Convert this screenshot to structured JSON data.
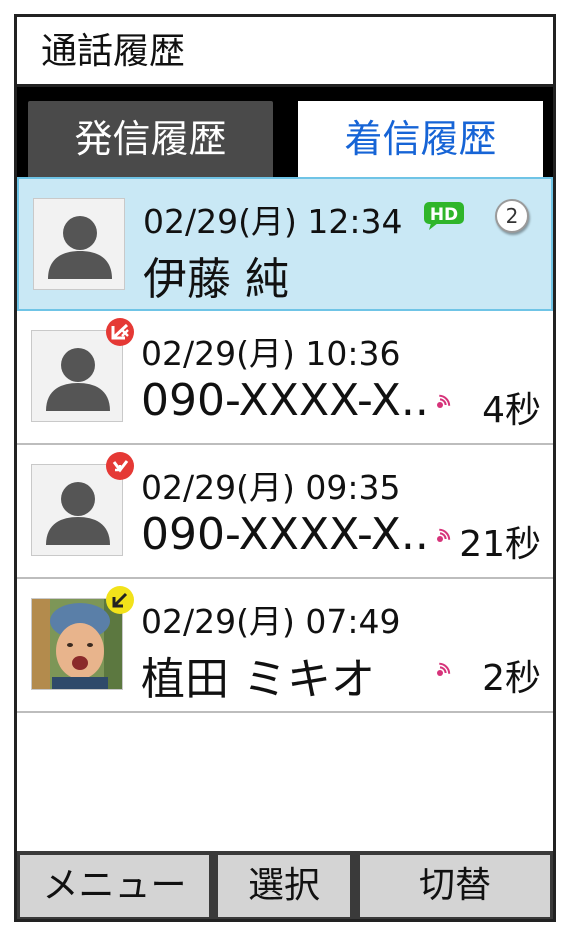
{
  "header": {
    "title": "通話履歴"
  },
  "tabs": [
    {
      "label": "発信履歴",
      "active": false
    },
    {
      "label": "着信履歴",
      "active": true
    }
  ],
  "colors": {
    "accent_blue": "#1664d6",
    "selected_row": "#c9e8f5",
    "hd_green": "#2fb52a",
    "missed_red": "#e53935",
    "incoming_yellow": "#f2e21a",
    "ring_pink": "#d6337a"
  },
  "calls": [
    {
      "time": "02/29(月) 12:34",
      "name": "伊藤 純",
      "hd": "HD",
      "count": "2",
      "duration": "",
      "avatar": "person-silhouette",
      "badge": "",
      "selected": true
    },
    {
      "time": "02/29(月) 10:36",
      "name": "090-XXXX-X..",
      "duration": "4秒",
      "avatar": "person-silhouette",
      "badge": "missed-call-icon",
      "selected": false
    },
    {
      "time": "02/29(月) 09:35",
      "name": "090-XXXX-X..",
      "duration": "21秒",
      "avatar": "person-silhouette",
      "badge": "missed-call-icon",
      "selected": false
    },
    {
      "time": "02/29(月) 07:49",
      "name": "植田 ミキオ",
      "duration": "2秒",
      "avatar": "contact-photo",
      "badge": "incoming-call-icon",
      "selected": false
    }
  ],
  "softkeys": {
    "menu": "メニュー",
    "select": "選択",
    "switch": "切替"
  }
}
